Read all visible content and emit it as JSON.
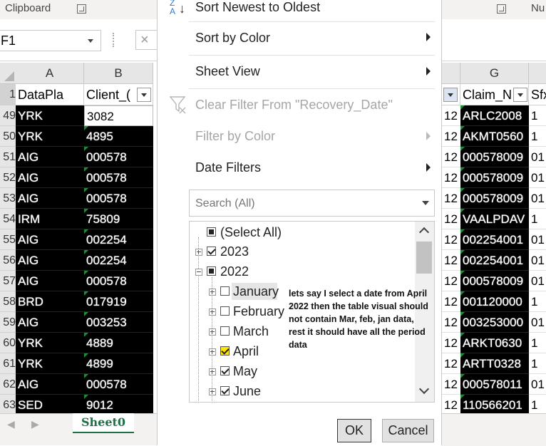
{
  "ribbon": {
    "left_group": "Clipboard",
    "right_group": "Nu"
  },
  "name_box": {
    "value": "F1"
  },
  "columns": {
    "A": "A",
    "B": "B",
    "G": "G"
  },
  "headers": {
    "a": "DataPla",
    "b": "Client_(",
    "g": "Claim_N",
    "h": "Sfx"
  },
  "row_numbers": [
    "1",
    "49",
    "50",
    "51",
    "52",
    "53",
    "54",
    "55",
    "56",
    "57",
    "58",
    "59",
    "60",
    "61",
    "62",
    "63"
  ],
  "rows": [
    {
      "a": "YRK",
      "b": "3082",
      "f": "12",
      "g": "ARLC2008",
      "h": "1"
    },
    {
      "a": "YRK",
      "b": "4895",
      "f": "12",
      "g": "AKMT0560",
      "h": "1"
    },
    {
      "a": "AIG",
      "b": "000578",
      "f": "12",
      "g": "000578009",
      "h": "01"
    },
    {
      "a": "AIG",
      "b": "000578",
      "f": "12",
      "g": "000578009",
      "h": "01"
    },
    {
      "a": "AIG",
      "b": "000578",
      "f": "12",
      "g": "000578009",
      "h": "01"
    },
    {
      "a": "IRM",
      "b": "75809",
      "f": "12",
      "g": "VAALPDAV",
      "h": "1"
    },
    {
      "a": "AIG",
      "b": "002254",
      "f": "12",
      "g": "002254001",
      "h": "01"
    },
    {
      "a": "AIG",
      "b": "002254",
      "f": "12",
      "g": "002254001",
      "h": "01"
    },
    {
      "a": "AIG",
      "b": "000578",
      "f": "12",
      "g": "000578009",
      "h": "01"
    },
    {
      "a": "BRD",
      "b": "017919",
      "f": "12",
      "g": "001120000",
      "h": "1"
    },
    {
      "a": "AIG",
      "b": "003253",
      "f": "12",
      "g": "003253000",
      "h": "01"
    },
    {
      "a": "YRK",
      "b": "4889",
      "f": "12",
      "g": "ARKT0630",
      "h": "1"
    },
    {
      "a": "YRK",
      "b": "4899",
      "f": "12",
      "g": "ARTT0328",
      "h": "1"
    },
    {
      "a": "AIG",
      "b": "000578",
      "f": "12",
      "g": "000578011",
      "h": "01"
    },
    {
      "a": "SED",
      "b": "9012",
      "f": "12",
      "g": "110566201",
      "h": "1"
    }
  ],
  "sheet_tab": "Sheet0",
  "menu": {
    "sort_newest": "Sort Newest to Oldest",
    "sort_by_color": "Sort by Color",
    "sheet_view": "Sheet View",
    "clear_filter": "Clear Filter From \"Recovery_Date\"",
    "filter_by_color": "Filter by Color",
    "date_filters": "Date Filters"
  },
  "search": {
    "placeholder": "Search (All)"
  },
  "tree": {
    "select_all": "(Select All)",
    "y2023": "2023",
    "y2022": "2022",
    "months": [
      "January",
      "February",
      "March",
      "April",
      "May",
      "June"
    ]
  },
  "annotation": "lets say I select a date from April 2022 then the table visual should not contain Mar, feb, jan data, rest it should have all the period data",
  "buttons": {
    "ok": "OK",
    "cancel": "Cancel"
  }
}
